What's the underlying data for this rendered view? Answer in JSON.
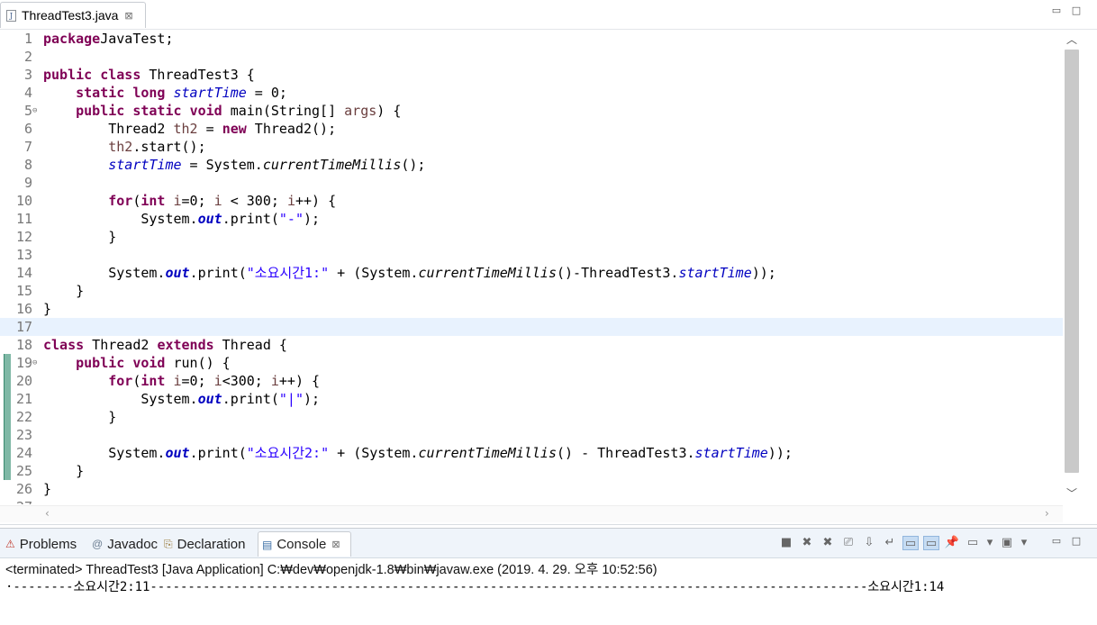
{
  "editor": {
    "tab_label": "ThreadTest3.java",
    "file_icon_glyph": "J",
    "close_glyph": "⊠",
    "minimize_glyph": "▭",
    "maximize_glyph": "□",
    "current_line": 17,
    "changed_lines": [
      19,
      25
    ]
  },
  "code": {
    "lines": [
      {
        "n": "1"
      },
      {
        "n": "2"
      },
      {
        "n": "3"
      },
      {
        "n": "4"
      },
      {
        "n": "5",
        "fold": "⊖"
      },
      {
        "n": "6"
      },
      {
        "n": "7"
      },
      {
        "n": "8"
      },
      {
        "n": "9"
      },
      {
        "n": "10"
      },
      {
        "n": "11"
      },
      {
        "n": "12"
      },
      {
        "n": "13"
      },
      {
        "n": "14"
      },
      {
        "n": "15"
      },
      {
        "n": "16"
      },
      {
        "n": "17"
      },
      {
        "n": "18"
      },
      {
        "n": "19",
        "fold": "⊖"
      },
      {
        "n": "20"
      },
      {
        "n": "21"
      },
      {
        "n": "22"
      },
      {
        "n": "23"
      },
      {
        "n": "24"
      },
      {
        "n": "25"
      },
      {
        "n": "26"
      },
      {
        "n": "27"
      }
    ],
    "tokens": [
      [
        [
          "kw",
          "package"
        ],
        [
          "",
          "JavaTest;"
        ]
      ],
      [],
      [
        [
          "kw",
          "public"
        ],
        [
          "",
          " "
        ],
        [
          "kw",
          "class"
        ],
        [
          "",
          " ThreadTest3 {"
        ]
      ],
      [
        [
          "",
          "    "
        ],
        [
          "kw",
          "static"
        ],
        [
          "",
          " "
        ],
        [
          "kw",
          "long"
        ],
        [
          "",
          " "
        ],
        [
          "fld",
          "startTime"
        ],
        [
          "",
          " = 0;"
        ]
      ],
      [
        [
          "",
          "    "
        ],
        [
          "kw",
          "public"
        ],
        [
          "",
          " "
        ],
        [
          "kw",
          "static"
        ],
        [
          "",
          " "
        ],
        [
          "kw",
          "void"
        ],
        [
          "",
          " main(String[] "
        ],
        [
          "var",
          "args"
        ],
        [
          "",
          ") {"
        ]
      ],
      [
        [
          "",
          "        Thread2 "
        ],
        [
          "var",
          "th2"
        ],
        [
          "",
          " = "
        ],
        [
          "kw",
          "new"
        ],
        [
          "",
          " Thread2();"
        ]
      ],
      [
        [
          "",
          "        "
        ],
        [
          "var",
          "th2"
        ],
        [
          "",
          ".start();"
        ]
      ],
      [
        [
          "",
          "        "
        ],
        [
          "fld",
          "startTime"
        ],
        [
          "",
          " = System."
        ],
        [
          "smeth",
          "currentTimeMillis"
        ],
        [
          "",
          "();"
        ]
      ],
      [],
      [
        [
          "",
          "        "
        ],
        [
          "kw",
          "for"
        ],
        [
          "",
          "("
        ],
        [
          "kw",
          "int"
        ],
        [
          "",
          " "
        ],
        [
          "var",
          "i"
        ],
        [
          "",
          "=0; "
        ],
        [
          "var",
          "i"
        ],
        [
          "",
          " < 300; "
        ],
        [
          "var",
          "i"
        ],
        [
          "",
          "++) {"
        ]
      ],
      [
        [
          "",
          "            System."
        ],
        [
          "sfld",
          "out"
        ],
        [
          "",
          ".print("
        ],
        [
          "str",
          "\"-\""
        ],
        [
          "",
          ");"
        ]
      ],
      [
        [
          "",
          "        }"
        ]
      ],
      [],
      [
        [
          "",
          "        System."
        ],
        [
          "sfld",
          "out"
        ],
        [
          "",
          ".print("
        ],
        [
          "str",
          "\"소요시간1:\""
        ],
        [
          "",
          " + (System."
        ],
        [
          "smeth",
          "currentTimeMillis"
        ],
        [
          "",
          "()-ThreadTest3."
        ],
        [
          "fld",
          "startTime"
        ],
        [
          "",
          "));"
        ]
      ],
      [
        [
          "",
          "    }"
        ]
      ],
      [
        [
          "",
          "}"
        ]
      ],
      [],
      [
        [
          "kw",
          "class"
        ],
        [
          "",
          " Thread2 "
        ],
        [
          "kw",
          "extends"
        ],
        [
          "",
          " Thread {"
        ]
      ],
      [
        [
          "",
          "    "
        ],
        [
          "kw",
          "public"
        ],
        [
          "",
          " "
        ],
        [
          "kw",
          "void"
        ],
        [
          "",
          " run() {"
        ]
      ],
      [
        [
          "",
          "        "
        ],
        [
          "kw",
          "for"
        ],
        [
          "",
          "("
        ],
        [
          "kw",
          "int"
        ],
        [
          "",
          " "
        ],
        [
          "var",
          "i"
        ],
        [
          "",
          "=0; "
        ],
        [
          "var",
          "i"
        ],
        [
          "",
          "<300; "
        ],
        [
          "var",
          "i"
        ],
        [
          "",
          "++) {"
        ]
      ],
      [
        [
          "",
          "            System."
        ],
        [
          "sfld",
          "out"
        ],
        [
          "",
          ".print("
        ],
        [
          "str",
          "\"|\""
        ],
        [
          "",
          ");"
        ]
      ],
      [
        [
          "",
          "        }"
        ]
      ],
      [],
      [
        [
          "",
          "        System."
        ],
        [
          "sfld",
          "out"
        ],
        [
          "",
          ".print("
        ],
        [
          "str",
          "\"소요시간2:\""
        ],
        [
          "",
          " + (System."
        ],
        [
          "smeth",
          "currentTimeMillis"
        ],
        [
          "",
          "() - ThreadTest3."
        ],
        [
          "fld",
          "startTime"
        ],
        [
          "",
          "));"
        ]
      ],
      [
        [
          "",
          "    }"
        ]
      ],
      [
        [
          "",
          "}"
        ]
      ],
      []
    ]
  },
  "panel": {
    "tabs": [
      {
        "label": "Problems",
        "icon": "problems-icon",
        "glyph": "⚠",
        "color": "#c0392b"
      },
      {
        "label": "Javadoc",
        "icon": "javadoc-icon",
        "glyph": "@",
        "color": "#6b7d91"
      },
      {
        "label": "Declaration",
        "icon": "declaration-icon",
        "glyph": "⎘",
        "color": "#9a7b3c"
      },
      {
        "label": "Console",
        "icon": "console-icon",
        "glyph": "▤",
        "color": "#3b6ea5",
        "active": true
      }
    ],
    "toolbar": [
      {
        "name": "terminate-icon",
        "glyph": "■"
      },
      {
        "name": "remove-launch-icon",
        "glyph": "✖"
      },
      {
        "name": "remove-all-launches-icon",
        "glyph": "✖"
      },
      {
        "name": "clear-console-icon",
        "glyph": "⎚"
      },
      {
        "name": "scroll-lock-icon",
        "glyph": "⇩"
      },
      {
        "name": "word-wrap-icon",
        "glyph": "↵"
      },
      {
        "name": "show-on-output-icon",
        "glyph": "▭",
        "selected": true
      },
      {
        "name": "show-on-error-icon",
        "glyph": "▭",
        "selected": true
      },
      {
        "name": "pin-console-icon",
        "glyph": "📌"
      },
      {
        "name": "display-console-icon",
        "glyph": "▭"
      },
      {
        "name": "display-console-dropdown-icon",
        "glyph": "▾"
      },
      {
        "name": "open-console-icon",
        "glyph": "▣"
      },
      {
        "name": "open-console-dropdown-icon",
        "glyph": "▾"
      }
    ],
    "terminated_text": "<terminated> ThreadTest3 [Java Application] C:₩dev₩openjdk-1.8₩bin₩javaw.exe (2019. 4. 29. 오후 10:52:56)",
    "output_text": "·--------소요시간2:11-----------------------------------------------------------------------------------------------소요시간1:14"
  }
}
